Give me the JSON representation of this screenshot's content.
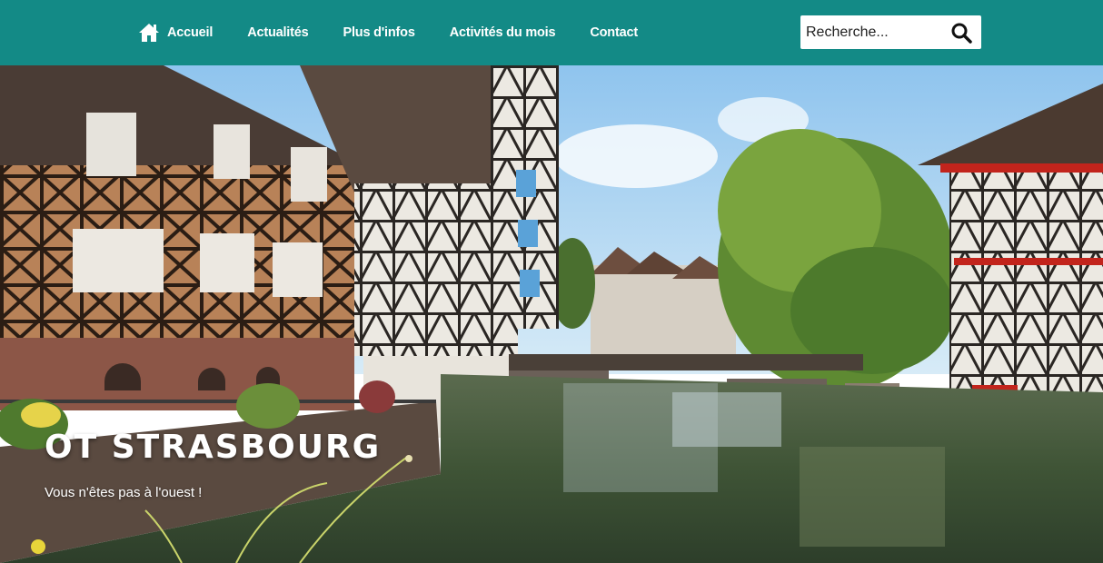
{
  "nav": {
    "items": [
      {
        "label": "Accueil",
        "icon": "home-icon"
      },
      {
        "label": "Actualités"
      },
      {
        "label": "Plus d'infos"
      },
      {
        "label": "Activités du mois"
      },
      {
        "label": "Contact"
      }
    ]
  },
  "search": {
    "placeholder": "Recherche...",
    "icon": "search-icon"
  },
  "hero": {
    "title": "OT STRASBOURG",
    "subtitle": "Vous n'êtes pas à l'ouest !"
  },
  "colors": {
    "navbar": "#138a86",
    "text": "#ffffff"
  }
}
